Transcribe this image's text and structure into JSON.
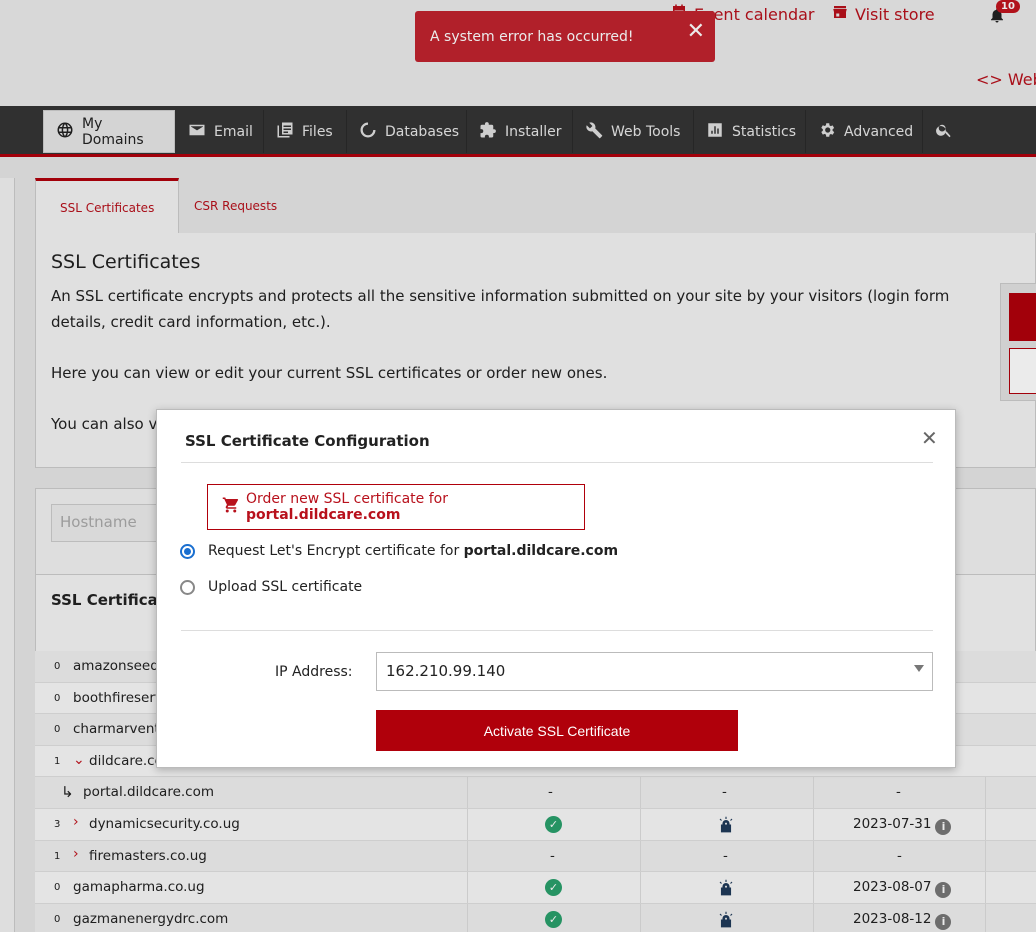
{
  "header": {
    "event_calendar": "Event calendar",
    "visit_store": "Visit store",
    "notifications_count": "10",
    "web_dev": "<> Web"
  },
  "toast": {
    "message": "A system error has occurred!",
    "close": "✕"
  },
  "nav": {
    "items": [
      {
        "label": "My Domains",
        "icon": "globe-icon"
      },
      {
        "label": "Email",
        "icon": "envelope-icon"
      },
      {
        "label": "Files",
        "icon": "files-icon"
      },
      {
        "label": "Databases",
        "icon": "database-icon"
      },
      {
        "label": "Installer",
        "icon": "puzzle-icon"
      },
      {
        "label": "Web Tools",
        "icon": "wrench-icon"
      },
      {
        "label": "Statistics",
        "icon": "chart-icon"
      },
      {
        "label": "Advanced",
        "icon": "gear-icon"
      }
    ]
  },
  "tabs": [
    "SSL Certificates",
    "CSR Requests"
  ],
  "intro": {
    "title": "SSL Certificates",
    "p1": "An SSL certificate encrypts and protects all the sensitive information submitted on your site by your visitors (login form details, credit card information, etc.).",
    "p2": "Here you can view or edit your current SSL certificates or order new ones.",
    "p3": "You can also vi"
  },
  "search": {
    "placeholder": "Hostname"
  },
  "table": {
    "title": "SSL Certificat",
    "rows": [
      {
        "count": "0",
        "domain": "amazonseeds",
        "ssl": "",
        "lock": "",
        "expiry": ""
      },
      {
        "count": "0",
        "domain": "boothfireserv",
        "ssl": "",
        "lock": "",
        "expiry": ""
      },
      {
        "count": "0",
        "domain": "charmarventu",
        "ssl": "",
        "lock": "",
        "expiry": ""
      },
      {
        "count": "1",
        "domain": "dildcare.co",
        "ssl": "",
        "lock": "",
        "expiry": ""
      },
      {
        "count": "",
        "domain": "portal.dildcare.com",
        "ssl": "-",
        "lock": "-",
        "expiry": "-"
      },
      {
        "count": "3",
        "domain": "dynamicsecurity.co.ug",
        "ssl": "ok",
        "lock": "lock",
        "expiry": "2023-07-31"
      },
      {
        "count": "1",
        "domain": "firemasters.co.ug",
        "ssl": "-",
        "lock": "-",
        "expiry": "-"
      },
      {
        "count": "0",
        "domain": "gamapharma.co.ug",
        "ssl": "ok",
        "lock": "lock",
        "expiry": "2023-08-07"
      },
      {
        "count": "0",
        "domain": "gazmanenergydrc.com",
        "ssl": "ok",
        "lock": "lock",
        "expiry": "2023-08-12"
      }
    ]
  },
  "modal": {
    "title": "SSL Certificate Configuration",
    "close": "✕",
    "order_prefix": "Order new SSL certificate for ",
    "order_domain": "portal.dildcare.com",
    "radio1_prefix": "Request Let's Encrypt certificate for ",
    "radio1_domain": "portal.dildcare.com",
    "radio2": "Upload SSL certificate",
    "ip_label": "IP Address:",
    "ip_value": "162.210.99.140",
    "activate": "Activate SSL Certificate"
  }
}
